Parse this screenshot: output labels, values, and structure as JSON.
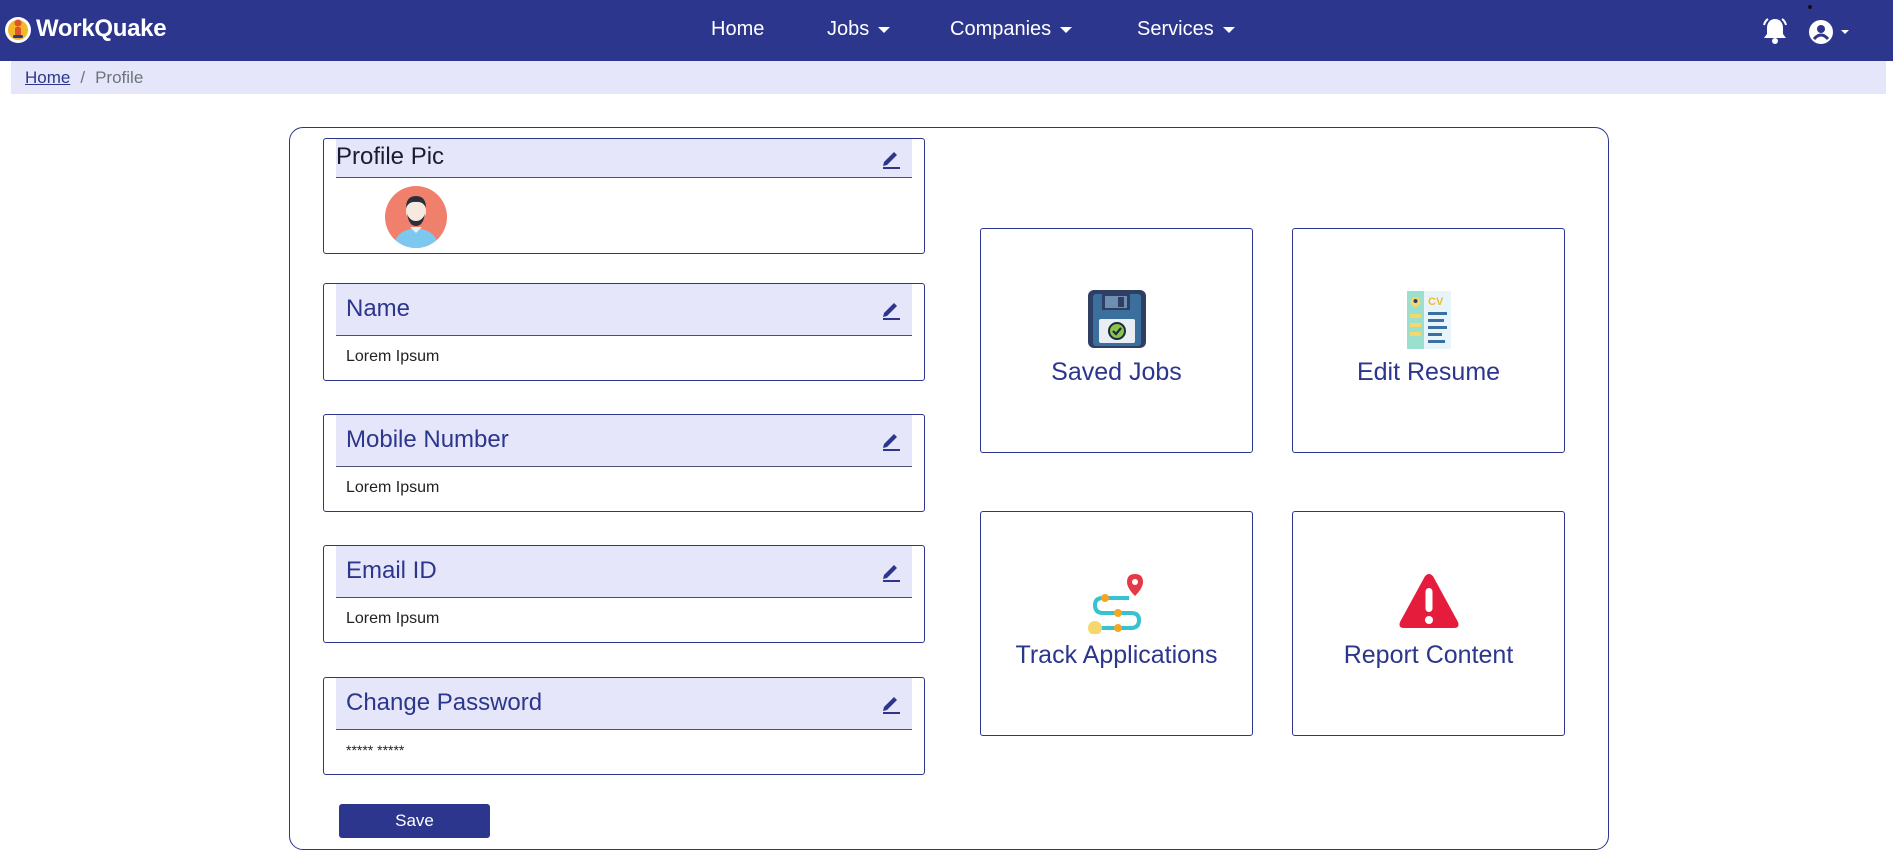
{
  "navbar": {
    "brand": "WorkQuake",
    "links": [
      {
        "label": "Home"
      },
      {
        "label": "Jobs"
      },
      {
        "label": "Companies"
      },
      {
        "label": "Services"
      }
    ],
    "icons": {
      "notifications": "bell-icon",
      "account": "user-circle-icon"
    }
  },
  "breadcrumb": {
    "home": "Home",
    "separator": "/",
    "current": "Profile"
  },
  "profile": {
    "pic": {
      "title": "Profile Pic"
    },
    "fields": [
      {
        "title": "Name",
        "value": "Lorem Ipsum"
      },
      {
        "title": "Mobile Number",
        "value": "Lorem Ipsum"
      },
      {
        "title": "Email ID",
        "value": "Lorem Ipsum"
      },
      {
        "title": "Change Password",
        "value": "***** *****"
      }
    ],
    "save_label": "Save"
  },
  "tiles": [
    {
      "label": "Saved Jobs",
      "icon": "floppy-disk-icon"
    },
    {
      "label": "Edit Resume",
      "icon": "cv-document-icon"
    },
    {
      "label": "Track Applications",
      "icon": "route-tracking-icon"
    },
    {
      "label": "Report Content",
      "icon": "warning-icon"
    }
  ],
  "colors": {
    "primary": "#2b368c",
    "accent_light": "#e6e6fa"
  }
}
